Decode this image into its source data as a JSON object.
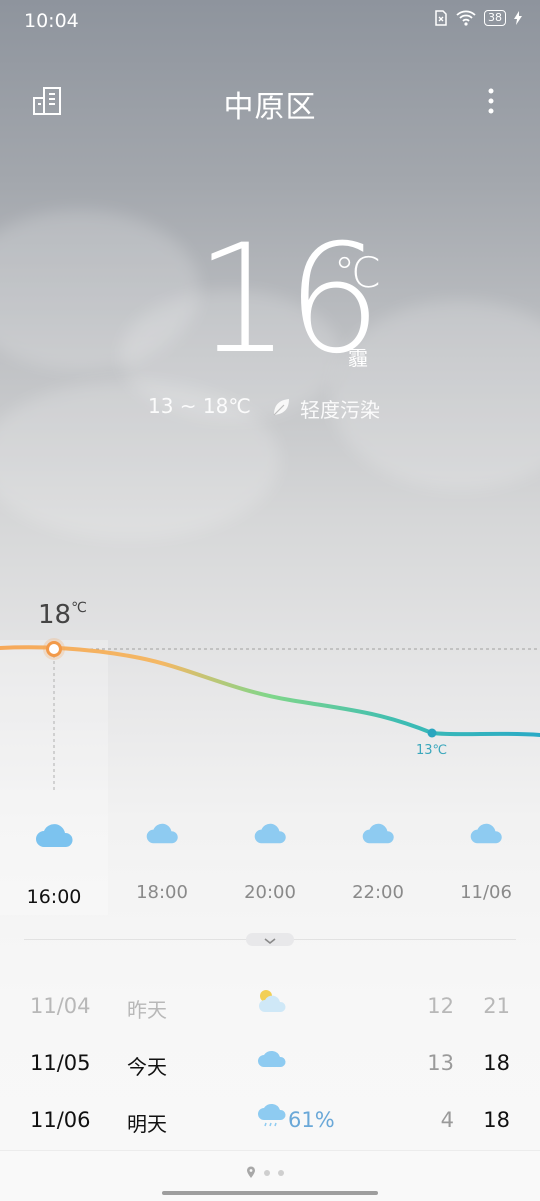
{
  "status": {
    "time": "10:04",
    "battery": "38"
  },
  "header": {
    "city": "中原区"
  },
  "current": {
    "temp": "16",
    "unit": "℃",
    "condition": "霾",
    "range": "13 ~ 18℃",
    "aqi": "轻度污染",
    "chart_current": "18",
    "chart_current_unit": "℃",
    "chart_min": "13℃"
  },
  "hourly": [
    {
      "time": "16:00",
      "icon": "cloud-icon",
      "active": true
    },
    {
      "time": "18:00",
      "icon": "cloud-icon"
    },
    {
      "time": "20:00",
      "icon": "cloud-icon"
    },
    {
      "time": "22:00",
      "icon": "cloud-icon"
    },
    {
      "time": "11/06",
      "icon": "cloud-icon"
    }
  ],
  "daily": [
    {
      "date": "11/04",
      "name": "昨天",
      "icon": "partly-sunny-icon",
      "low": "12",
      "high": "21"
    },
    {
      "date": "11/05",
      "name": "今天",
      "icon": "cloud-icon",
      "low": "13",
      "high": "18"
    },
    {
      "date": "11/06",
      "name": "明天",
      "icon": "rain-cloud-icon",
      "rain": "61%",
      "low": "4",
      "high": "18"
    }
  ],
  "colors": {
    "warm": "#f5ad5f",
    "mid": "#79d58a",
    "cool": "#2bb0c8"
  }
}
